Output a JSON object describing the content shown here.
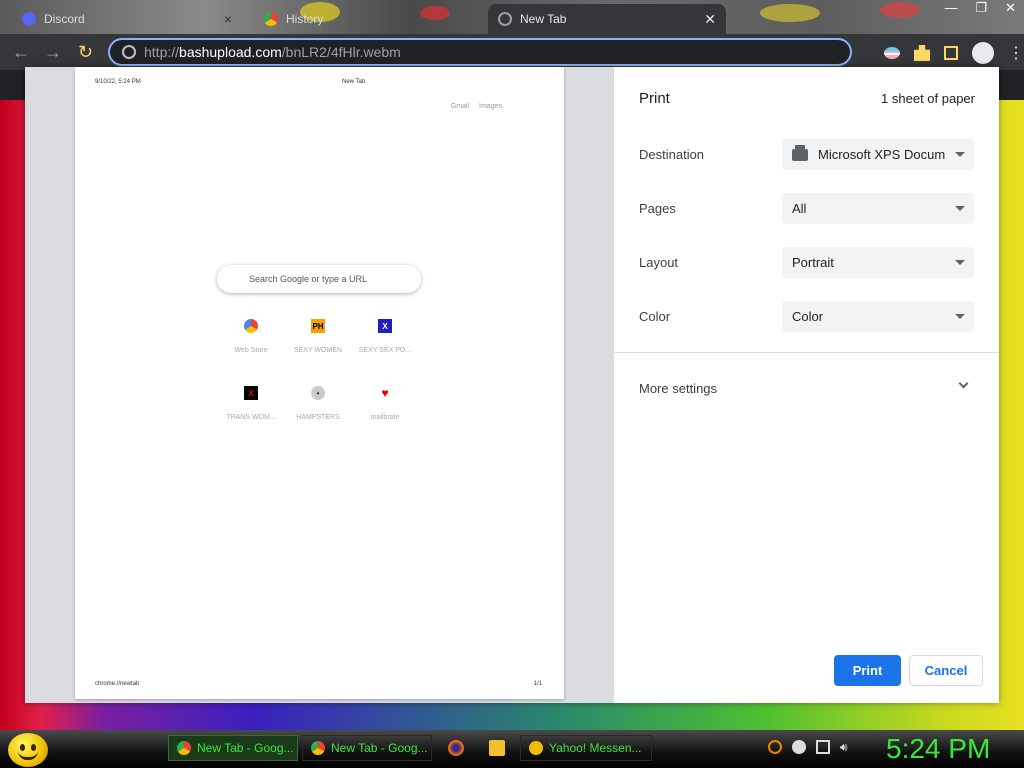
{
  "browser": {
    "tabs": [
      {
        "label": "Discord",
        "active": false
      },
      {
        "label": "History",
        "active": false
      },
      {
        "label": "New Tab",
        "active": true
      }
    ],
    "url_scheme": "http://",
    "url_host": "bashupload.com",
    "url_path": "/bnLR2/4fHlr.webm"
  },
  "preview": {
    "header_date": "9/10/22, 5:24 PM",
    "header_title": "New Tab",
    "toplinks": [
      "Gmail",
      "Images"
    ],
    "search_placeholder": "Search Google or type a URL",
    "tiles": [
      {
        "label": "Web Store",
        "icon": "webstore-icon"
      },
      {
        "label": "SEXY WOMEN",
        "icon": "ph-icon"
      },
      {
        "label": "SEXY SEX PO...",
        "icon": "x-icon"
      },
      {
        "label": "TRANS WOM...",
        "icon": "x-red-icon"
      },
      {
        "label": "HAMPSTERS",
        "icon": "hamster-icon"
      },
      {
        "label": "mailbrate",
        "icon": "heart-icon"
      }
    ],
    "footer_url": "chrome://newtab",
    "footer_page": "1/1"
  },
  "print": {
    "title": "Print",
    "sheets": "1 sheet of paper",
    "destination_label": "Destination",
    "destination_value": "Microsoft XPS Docum",
    "pages_label": "Pages",
    "pages_value": "All",
    "layout_label": "Layout",
    "layout_value": "Portrait",
    "color_label": "Color",
    "color_value": "Color",
    "more_settings": "More settings",
    "print_button": "Print",
    "cancel_button": "Cancel"
  },
  "taskbar": {
    "tasks": [
      {
        "label": "New Tab - Goog...",
        "active": true
      },
      {
        "label": "New Tab - Goog...",
        "active": false
      },
      {
        "label": "Yahoo! Messen...",
        "active": false
      }
    ],
    "clock": "5:24 PM"
  },
  "colors": {
    "accent": "#1a73e8",
    "clock_green": "#3ae83a"
  }
}
